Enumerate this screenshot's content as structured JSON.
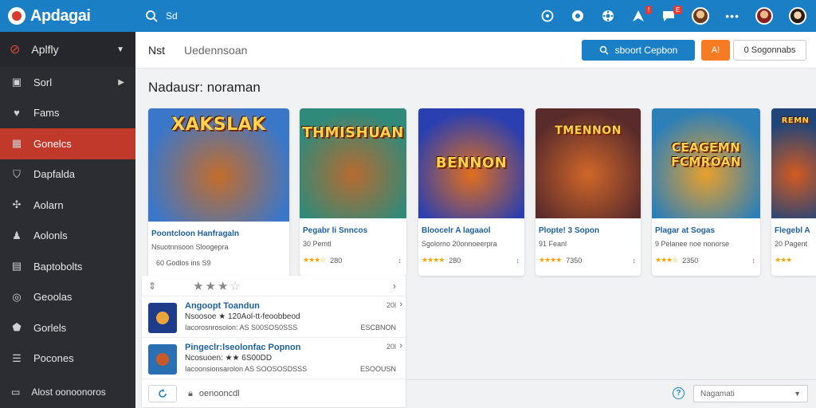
{
  "app": {
    "title": "Apdagai"
  },
  "topbar": {
    "search_text": "Sd",
    "notification_badge": "!",
    "message_badge": "E"
  },
  "sidebar": {
    "header": "Aplfly",
    "items": [
      {
        "label": "Sorl",
        "icon": "home-icon",
        "has_chevron": true
      },
      {
        "label": "Fams",
        "icon": "heart-icon"
      },
      {
        "label": "Gonelcs",
        "icon": "grid-icon",
        "active": true
      },
      {
        "label": "Dapfalda",
        "icon": "shield-icon"
      },
      {
        "label": "Aolarn",
        "icon": "gear-icon"
      },
      {
        "label": "Aolonls",
        "icon": "user-icon"
      },
      {
        "label": "Baptobolts",
        "icon": "store-icon"
      },
      {
        "label": "Geoolas",
        "icon": "target-icon"
      },
      {
        "label": "Gorlels",
        "icon": "badge-icon"
      },
      {
        "label": "Pocones",
        "icon": "list-icon"
      }
    ],
    "footer": "Alost oonoonoros"
  },
  "header": {
    "title": "Nst",
    "subtitle": "Uedennsoan",
    "primary_button": "sboort Cepbon",
    "orange_button": "A!",
    "outline_button": "0  Sogonnabs"
  },
  "section": {
    "title": "Nadausr: noraman"
  },
  "cards": [
    {
      "art_title": "XAKSLAK",
      "title": "Poontcloon Hanfragaln",
      "subtitle": "Nsuotnnsoon Sloogepra",
      "foot_left": "60 Godlos  ins   S9",
      "stars": "",
      "foot_right": "",
      "colors": [
        "#3b77c9",
        "#c46d2a"
      ]
    },
    {
      "art_title": "THMISHUAN",
      "title": "Pegabr li Snncos",
      "subtitle": "30 Pemtl",
      "foot_left": "280",
      "stars": "★★★☆",
      "foot_right": "↕",
      "colors": [
        "#2f8a7a",
        "#b76b30"
      ]
    },
    {
      "art_title": "BENNON",
      "title": "Bloocelr A lagaaol",
      "subtitle": "Sgolorno 20onnoeerpra",
      "foot_left": "280",
      "stars": "★★★★",
      "foot_right": "↕",
      "colors": [
        "#2a3fb0",
        "#e26f1d"
      ]
    },
    {
      "art_title": "TMENNON",
      "title": "Plopte! 3 Sopon",
      "subtitle": "91 Feanl",
      "foot_left": "7350",
      "stars": "★★★★",
      "foot_right": "↕",
      "colors": [
        "#5a2b2b",
        "#d0672a"
      ]
    },
    {
      "art_title": "CEAGEMN FCMROAN",
      "title": "Plagar at Sogas",
      "subtitle": "9 Pelanee noe nonorse",
      "foot_left": "2350",
      "stars": "★★★☆",
      "foot_right": "↕",
      "colors": [
        "#2d7fb8",
        "#e8a02b"
      ]
    },
    {
      "art_title": "REMN",
      "title": "Flegebl A",
      "subtitle": "20 Pagent",
      "foot_left": "",
      "stars": "★★★",
      "foot_right": "",
      "colors": [
        "#20457a",
        "#d35b1f"
      ]
    }
  ],
  "list": {
    "rating_stars_filled": "★★★",
    "rating_stars_empty": "☆",
    "rows": [
      {
        "title": "Angoopt Toandun",
        "detail": "Nsoosoe ★ 120Aol-tt-feoobbeod",
        "meta": "Iacorosnrosolon: AS S00SOS0SSS",
        "meta_right": "ESCBNON",
        "count": "20l",
        "colors": [
          "#1f3c8a",
          "#e9a43a"
        ]
      },
      {
        "title": "Pingeclr:lseolonfac Popnon",
        "detail": "Ncosuoen: ★★ 6S00DD",
        "meta": "Iacoonsionsarolon AS SOOSOSDSSS",
        "meta_right": "ESOOUSN",
        "count": "20l",
        "colors": [
          "#2a6fb2",
          "#c85a2a"
        ]
      }
    ],
    "footer_text": "oenooncdl"
  },
  "footer_select": {
    "value": "Nagamati"
  }
}
